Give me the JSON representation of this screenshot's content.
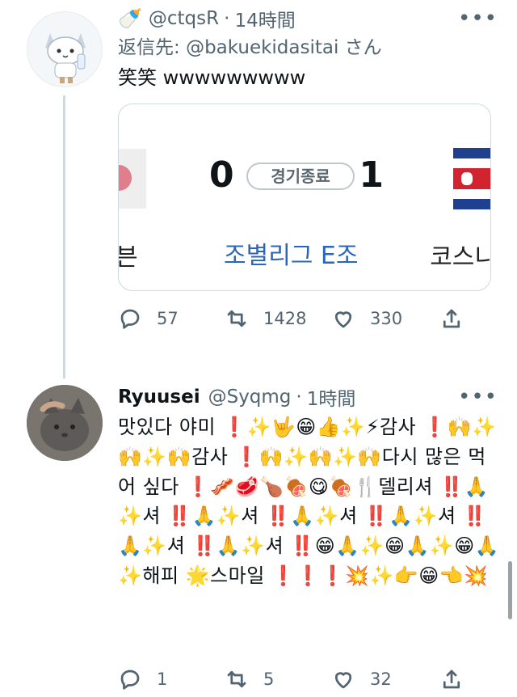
{
  "tweet1": {
    "handle": "@ctqsR",
    "time": "14時間",
    "more": "•••",
    "reply_prefix": "返信先: ",
    "reply_to": "@bakuekidasitai",
    "reply_suffix": " さん",
    "text": "笑笑 wwwwwwwww",
    "card": {
      "score_left": "0",
      "status": "경기종료",
      "score_right": "1",
      "left_team_partial": "븐",
      "group": "조별리그 E조",
      "right_team_partial": "코스니"
    },
    "actions": {
      "replies": "57",
      "retweets": "1428",
      "likes": "330"
    }
  },
  "tweet2": {
    "name": "Ryuusei",
    "handle": "@Syqmg",
    "time": "1時間",
    "more": "•••",
    "text": "맛있다 야미 ❗✨🤟😁👍✨⚡감사 ❗🙌✨🙌✨🙌감사 ❗🙌✨🙌✨🙌다시 많은 먹어 싶다 ❗🥓🥩🍗🍖😋🍖🍴델리셔 ‼️🙏✨셔 ‼️🙏✨셔 ‼️🙏✨셔 ‼️🙏✨셔 ‼️🙏✨셔 ‼️🙏✨셔 ‼️😁🙏✨😁🙏✨😁🙏✨해피 🌟스마일 ❗❗❗💥✨👉😁👈💥",
    "actions": {
      "replies": "1",
      "retweets": "5",
      "likes": "32"
    }
  },
  "icons": [
    "baby-bottle-icon",
    "reply-icon",
    "retweet-icon",
    "like-icon",
    "share-icon",
    "more-icon"
  ]
}
